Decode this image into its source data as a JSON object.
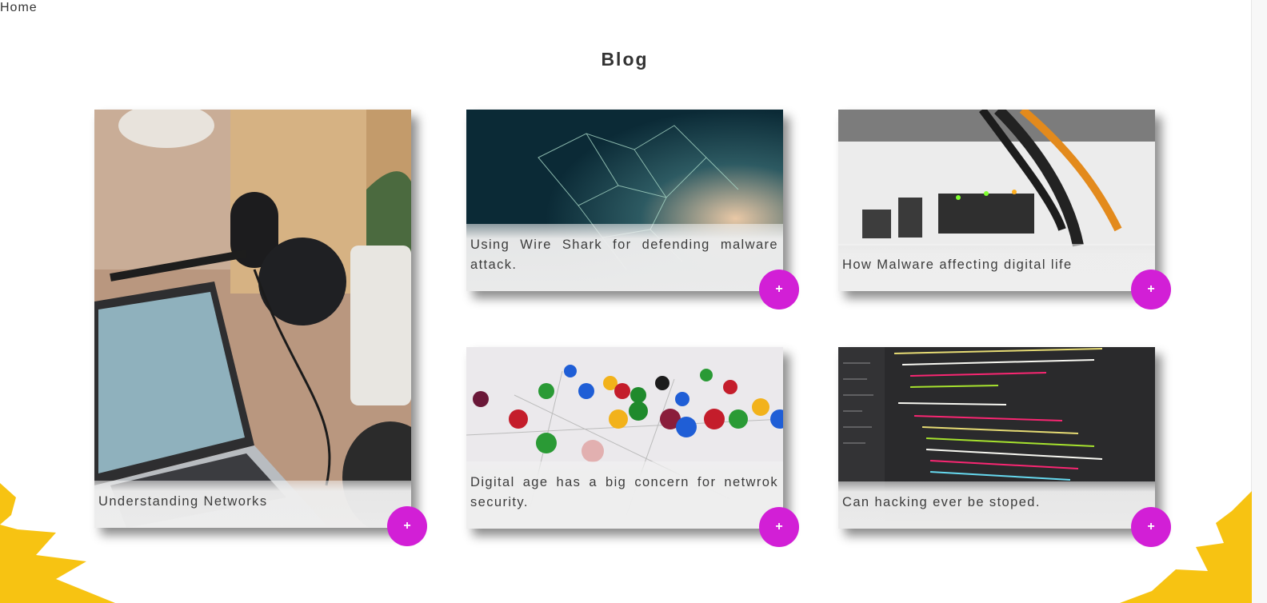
{
  "breadcrumb": {
    "home": "Home"
  },
  "page": {
    "title": "Blog"
  },
  "posts": [
    {
      "title": "Understanding Networks",
      "image": "microphone-laptop-photo"
    },
    {
      "title": "Using Wire Shark for defending malware attack.",
      "image": "network-web-photo"
    },
    {
      "title": "How Malware affecting digital life",
      "image": "router-ports-photo"
    },
    {
      "title": "Digital age has a big concern for netwrok security.",
      "image": "network-pawns-photo"
    },
    {
      "title": "Can hacking ever be stoped.",
      "image": "code-screen-photo"
    }
  ],
  "more_button": {
    "label": "+"
  },
  "colors": {
    "accent": "#d21fd6",
    "decoration": "#f7c312",
    "caption_bg": "#eeeeee"
  }
}
